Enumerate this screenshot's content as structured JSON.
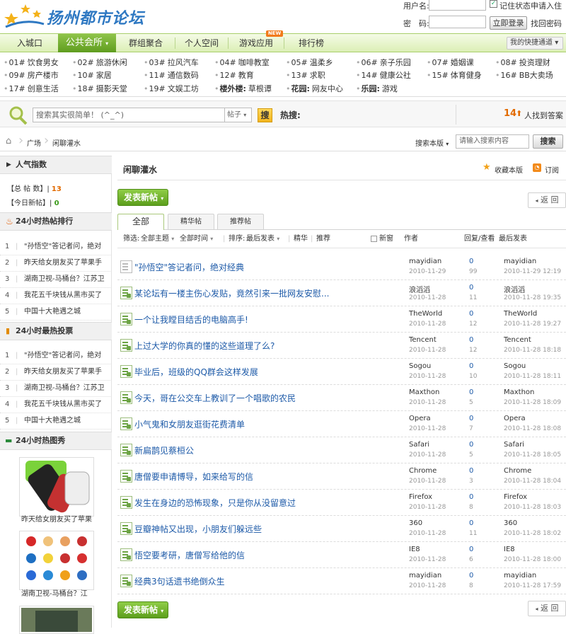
{
  "site": {
    "logo_text": "扬州都市论坛"
  },
  "login": {
    "username_label": "用户名:",
    "password_label": "密　码:",
    "remember_label": "记住状态",
    "register_link": "申请入住",
    "login_button": "立即登录",
    "forgot_link": "找回密码"
  },
  "nav": {
    "items": [
      "入城口",
      "公共会所",
      "群组聚合",
      "个人空间",
      "游戏应用",
      "排行榜"
    ],
    "new_badge": "NEW",
    "quick_label": "我的快捷通道"
  },
  "boards": [
    [
      {
        "num": "01#",
        "name": "饮食男女"
      },
      {
        "num": "02#",
        "name": "旅游休闲"
      },
      {
        "num": "03#",
        "name": "拉风汽车"
      },
      {
        "num": "04#",
        "name": "咖啡教室"
      },
      {
        "num": "05#",
        "name": "温柔乡"
      },
      {
        "num": "06#",
        "name": "亲子乐园"
      },
      {
        "num": "07#",
        "name": "婚姻课"
      },
      {
        "num": "08#",
        "name": "投资理财"
      }
    ],
    [
      {
        "num": "09#",
        "name": "房产楼市"
      },
      {
        "num": "10#",
        "name": "家居"
      },
      {
        "num": "11#",
        "name": "通信数码"
      },
      {
        "num": "12#",
        "name": "教育"
      },
      {
        "num": "13#",
        "name": "求职"
      },
      {
        "num": "14#",
        "name": "健康公社"
      },
      {
        "num": "15#",
        "name": "体育健身"
      },
      {
        "num": "16#",
        "name": "BB大卖场"
      }
    ],
    [
      {
        "num": "17#",
        "name": "创意生活"
      },
      {
        "num": "18#",
        "name": "摄影天堂"
      },
      {
        "num": "19#",
        "name": "文娱工坊"
      },
      {
        "num": "楼外楼:",
        "name": "草根谭"
      },
      {
        "num": "花园:",
        "name": "网友中心"
      },
      {
        "num": "乐园:",
        "name": "游戏"
      }
    ]
  ],
  "search": {
    "placeholder": "搜索其实很简单！ (^_^)",
    "scope": "帖子",
    "button": "搜",
    "hot_label": "热搜:",
    "count": "14",
    "count_suffix": "人找到答案"
  },
  "breadcrumb": {
    "items": [
      "广场",
      "闲聊灌水"
    ],
    "board_search_label": "搜索本版",
    "board_search_placeholder": "请输入搜索内容",
    "board_search_button": "搜索"
  },
  "sidebar": {
    "popularity_title": "人气指数",
    "total_label": "【总 帖 数】|",
    "total_value": "13",
    "today_label": "【今日新帖】|",
    "today_value": "0",
    "hot24_title": "24小时热帖排行",
    "hot24": [
      "\"孙悟空\"答记者问，绝对",
      "昨天给女朋友买了苹果手",
      "湖南卫视-马桶台？江苏卫",
      "我花五千块钱从黑市买了",
      "中国十大艳遇之城"
    ],
    "vote24_title": "24小时最热投票",
    "vote24": [
      "\"孙悟空\"答记者问，绝对",
      "昨天给女朋友买了苹果手",
      "湖南卫视-马桶台？江苏卫",
      "我花五千块钱从黑市买了",
      "中国十大艳遇之城"
    ],
    "pics_title": "24小时热图秀",
    "pics": [
      "昨天给女朋友买了苹果",
      "湖南卫视-马桶台？江"
    ]
  },
  "main": {
    "board_title": "闲聊灌水",
    "favorite": "收藏本版",
    "subscribe": "订阅",
    "post_button": "发表新帖",
    "back_button": "返 回",
    "tabs": [
      "全部",
      "精华帖",
      "推荐帖"
    ],
    "filter": {
      "label": "筛选:",
      "all_topics": "全部主题",
      "all_time": "全部时间",
      "sort_label": "排序:",
      "sort_value": "最后发表",
      "digest": "精华",
      "recommend": "推荐",
      "new_window": "新窗",
      "col_author": "作者",
      "col_reply": "回复/查看",
      "col_last": "最后发表"
    },
    "threads": [
      {
        "title": "\"孙悟空\"答记者问，绝对经典",
        "author": "mayidian",
        "date": "2010-11-29",
        "replies": "0",
        "views": "99",
        "last_user": "mayidian",
        "last_time": "2010-11-29 12:19",
        "icon": "plain"
      },
      {
        "title": "某论坛有一楼主伤心发贴，竟然引来一批网友安慰...",
        "author": "浪滔滔",
        "date": "2010-11-28",
        "replies": "0",
        "views": "11",
        "last_user": "浪滔滔",
        "last_time": "2010-11-28 19:35",
        "icon": "new"
      },
      {
        "title": "一个让我瞠目结舌的电脑高手!",
        "author": "TheWorld",
        "date": "2010-11-28",
        "replies": "0",
        "views": "12",
        "last_user": "TheWorld",
        "last_time": "2010-11-28 19:27",
        "icon": "new"
      },
      {
        "title": "上过大学的你真的懂的这些道理了么?",
        "author": "Tencent",
        "date": "2010-11-28",
        "replies": "0",
        "views": "12",
        "last_user": "Tencent",
        "last_time": "2010-11-28 18:18",
        "icon": "new"
      },
      {
        "title": "毕业后，班级的QQ群会这样发展",
        "author": "Sogou",
        "date": "2010-11-28",
        "replies": "0",
        "views": "10",
        "last_user": "Sogou",
        "last_time": "2010-11-28 18:11",
        "icon": "new"
      },
      {
        "title": "今天，哥在公交车上教训了一个唱歌的农民",
        "author": "Maxthon",
        "date": "2010-11-28",
        "replies": "0",
        "views": "5",
        "last_user": "Maxthon",
        "last_time": "2010-11-28 18:09",
        "icon": "new"
      },
      {
        "title": "小气鬼和女朋友逛街花费清单",
        "author": "Opera",
        "date": "2010-11-28",
        "replies": "0",
        "views": "7",
        "last_user": "Opera",
        "last_time": "2010-11-28 18:08",
        "icon": "new"
      },
      {
        "title": "新扁鹊见蔡桓公",
        "author": "Safari",
        "date": "2010-11-28",
        "replies": "0",
        "views": "5",
        "last_user": "Safari",
        "last_time": "2010-11-28 18:05",
        "icon": "new"
      },
      {
        "title": "唐僧要申请博导，如来给写的信",
        "author": "Chrome",
        "date": "2010-11-28",
        "replies": "0",
        "views": "3",
        "last_user": "Chrome",
        "last_time": "2010-11-28 18:04",
        "icon": "new"
      },
      {
        "title": "发生在身边的恐怖现象，只是你从没留意过",
        "author": "Firefox",
        "date": "2010-11-28",
        "replies": "0",
        "views": "8",
        "last_user": "Firefox",
        "last_time": "2010-11-28 18:03",
        "icon": "new"
      },
      {
        "title": "豆瓣神帖又出现，小朋友们躲远些",
        "author": "360",
        "date": "2010-11-28",
        "replies": "0",
        "views": "11",
        "last_user": "360",
        "last_time": "2010-11-28 18:02",
        "icon": "new"
      },
      {
        "title": "悟空要考研，唐僧写给他的信",
        "author": "IE8",
        "date": "2010-11-28",
        "replies": "0",
        "views": "6",
        "last_user": "IE8",
        "last_time": "2010-11-28 18:00",
        "icon": "new"
      },
      {
        "title": "经典3句话遗书绝倒众生",
        "author": "mayidian",
        "date": "2010-11-28",
        "replies": "0",
        "views": "8",
        "last_user": "mayidian",
        "last_time": "2010-11-28 17:59",
        "icon": "new"
      }
    ]
  },
  "colors": {
    "nav_active": "#6aa626",
    "link": "#1d5aa8",
    "accent_orange": "#e26a00",
    "post_green": "#6fb02b"
  }
}
